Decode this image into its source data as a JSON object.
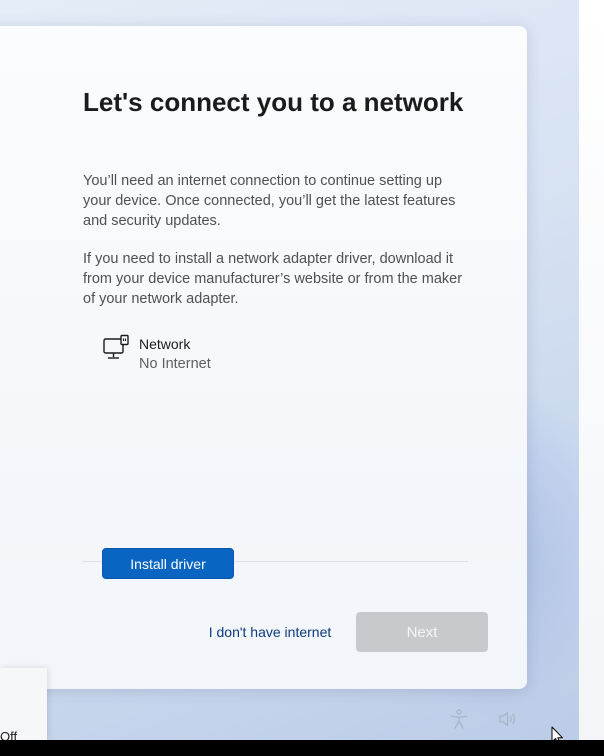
{
  "page": {
    "title": "Let's connect you to a network",
    "paragraph_1": "You’ll need an internet connection to continue setting up your device. Once connected, you’ll get the latest features and security updates.",
    "paragraph_2": "If you need to install a network adapter driver, download it from your device manufacturer’s website or from the maker of your network adapter."
  },
  "network": {
    "icon": "wired-network-icon",
    "name": "Network",
    "status": "No Internet"
  },
  "buttons": {
    "install_driver": "Install driver",
    "no_internet": "I don't have internet",
    "next": "Next",
    "next_enabled": false
  },
  "side_panel": {
    "partial_text": "Off"
  },
  "tray": {
    "icons": [
      "accessibility-icon",
      "volume-icon"
    ]
  },
  "colors": {
    "accent": "#0a64c2",
    "link": "#0d3b7e",
    "disabled_button": "#c7c9cd"
  }
}
